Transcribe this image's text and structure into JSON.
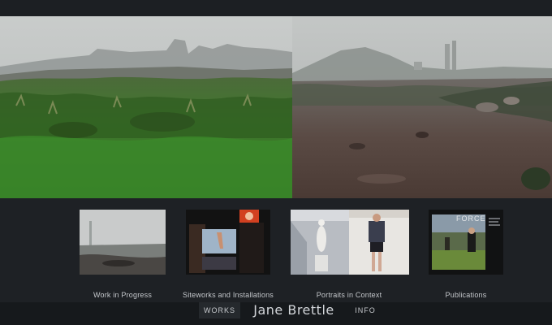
{
  "site": {
    "title": "Jane Brettle"
  },
  "nav": {
    "works_label": "WORKS",
    "info_label": "INFO"
  },
  "thumbnails": [
    {
      "caption": "Work in Progress"
    },
    {
      "caption": "Siteworks and Installations"
    },
    {
      "caption": "Portraits in Context"
    },
    {
      "caption": "Publications"
    }
  ],
  "publication_cover": {
    "text": "FORCE"
  },
  "colors": {
    "background": "#1b1e22",
    "grass": "#3c7a2a",
    "fog": "#c4c7c6",
    "soil": "#5a4a44"
  }
}
